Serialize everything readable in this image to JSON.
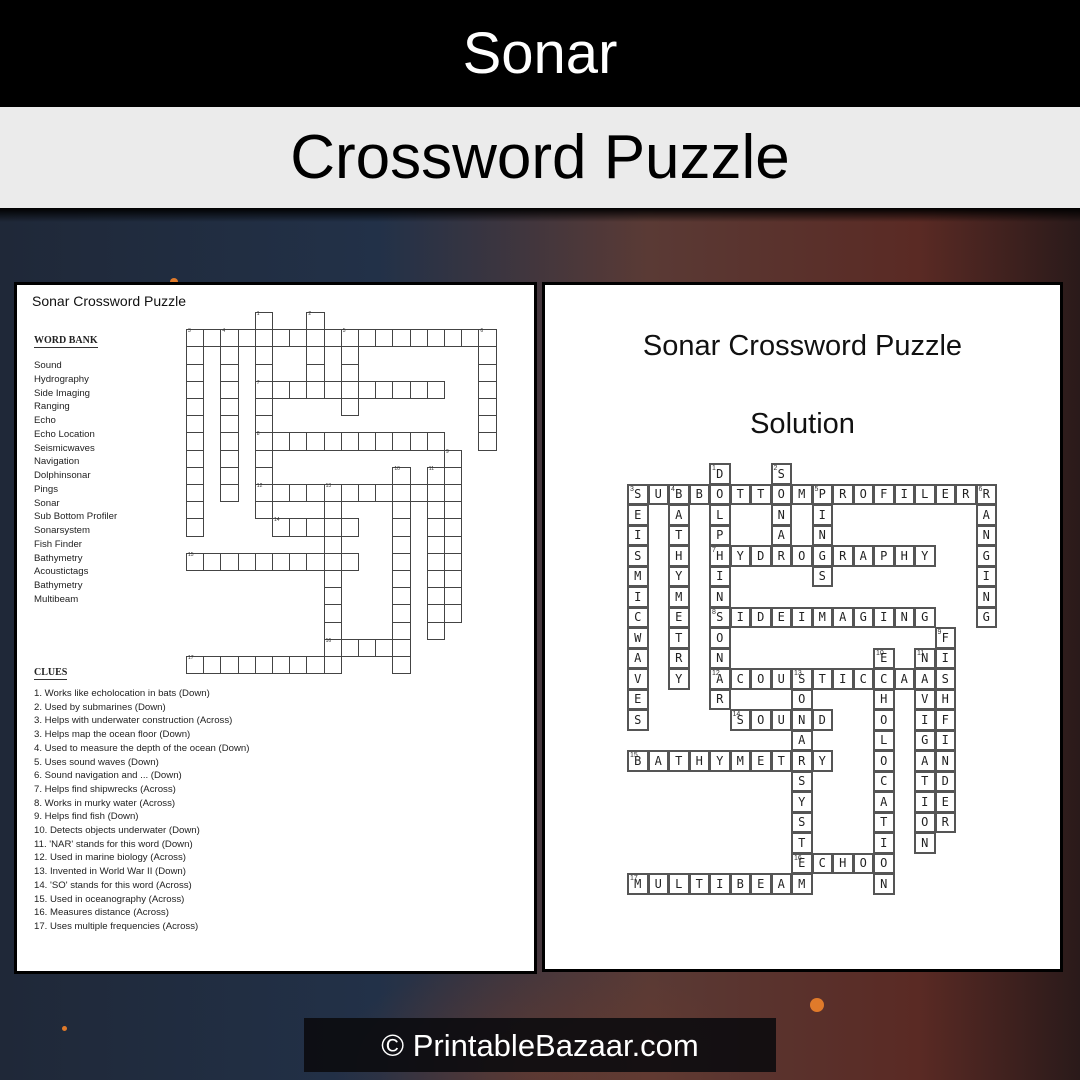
{
  "header": {
    "title": "Sonar",
    "subtitle": "Crossword Puzzle"
  },
  "puzzle_sheet": {
    "title": "Sonar Crossword Puzzle",
    "word_bank_heading": "WORD BANK",
    "word_bank": [
      "Sound",
      "Hydrography",
      "Side Imaging",
      "Ranging",
      "Echo",
      "Echo Location",
      "Seismicwaves",
      "Navigation",
      "Dolphinsonar",
      "Pings",
      "Sonar",
      "Sub Bottom Profiler",
      "Sonarsystem",
      "Fish Finder",
      "Bathymetry",
      "Acoustictags",
      "Bathymetry",
      "Multibeam"
    ],
    "clues_heading": "CLUES",
    "clues": [
      "1. Works like echolocation in bats (Down)",
      "2. Used by submarines (Down)",
      "3. Helps with underwater construction (Across)",
      "3. Helps map the ocean floor (Down)",
      "4. Used to measure the depth of the ocean (Down)",
      "5. Uses sound waves (Down)",
      "6. Sound navigation and ... (Down)",
      "7. Helps find shipwrecks (Across)",
      "8. Works in murky water (Across)",
      "9. Helps find fish (Down)",
      "10. Detects objects underwater (Down)",
      "11. 'NAR' stands for this word (Down)",
      "12. Used in marine biology (Across)",
      "13. Invented in World War II (Down)",
      "14. 'SO' stands for this word (Across)",
      "15. Used in oceanography (Across)",
      "16. Measures distance (Across)",
      "17. Uses multiple frequencies (Across)"
    ]
  },
  "solution_sheet": {
    "title": "Sonar Crossword Puzzle",
    "subtitle": "Solution"
  },
  "crossword": {
    "entries": [
      {
        "number": 1,
        "direction": "down",
        "answer": "DOLPHINSONAR",
        "col": 4,
        "row": 0
      },
      {
        "number": 2,
        "direction": "down",
        "answer": "SONAR",
        "col": 7,
        "row": 0
      },
      {
        "number": 3,
        "direction": "across",
        "answer": "SUBBOTTOMPROFILER",
        "col": 0,
        "row": 1
      },
      {
        "number": 3,
        "direction": "down",
        "answer": "SEISMICWAVES",
        "col": 0,
        "row": 1
      },
      {
        "number": 4,
        "direction": "down",
        "answer": "BATHYMETRY",
        "col": 2,
        "row": 1
      },
      {
        "number": 5,
        "direction": "down",
        "answer": "PINGS",
        "col": 9,
        "row": 1
      },
      {
        "number": 6,
        "direction": "down",
        "answer": "RANGING",
        "col": 17,
        "row": 1
      },
      {
        "number": 7,
        "direction": "across",
        "answer": "HYDROGRAPHY",
        "col": 4,
        "row": 4
      },
      {
        "number": 8,
        "direction": "across",
        "answer": "SIDEIMAGING",
        "col": 4,
        "row": 7
      },
      {
        "number": 9,
        "direction": "down",
        "answer": "FISHFINDER",
        "col": 15,
        "row": 8
      },
      {
        "number": 10,
        "direction": "down",
        "answer": "ECHOLOCATION",
        "col": 12,
        "row": 9
      },
      {
        "number": 11,
        "direction": "down",
        "answer": "NAVIGATION",
        "col": 14,
        "row": 9
      },
      {
        "number": 12,
        "direction": "across",
        "answer": "ACOUSTICTAGS",
        "col": 4,
        "row": 10
      },
      {
        "number": 13,
        "direction": "down",
        "answer": "SONARSYSTEM",
        "col": 8,
        "row": 10
      },
      {
        "number": 14,
        "direction": "across",
        "answer": "SOUND",
        "col": 5,
        "row": 12
      },
      {
        "number": 15,
        "direction": "across",
        "answer": "BATHYMETRY",
        "col": 0,
        "row": 14
      },
      {
        "number": 16,
        "direction": "across",
        "answer": "ECHO",
        "col": 8,
        "row": 19
      },
      {
        "number": 17,
        "direction": "across",
        "answer": "MULTIBEAM",
        "col": 0,
        "row": 20
      }
    ]
  },
  "footer": {
    "copyright": "© PrintableBazaar.com"
  }
}
